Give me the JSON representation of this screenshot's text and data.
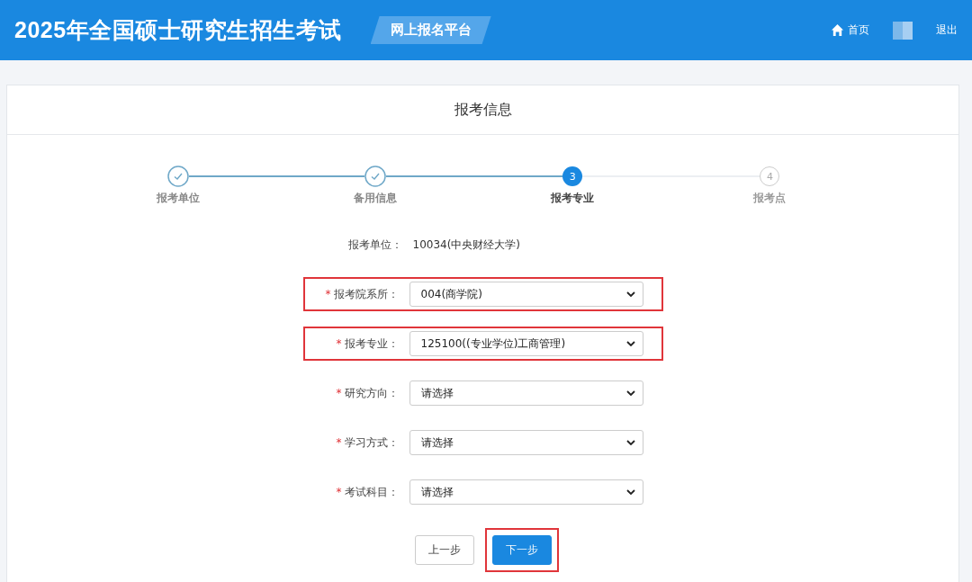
{
  "header": {
    "title": "2025年全国硕士研究生招生考试",
    "badge": "网上报名平台",
    "nav": [
      {
        "kind": "home",
        "label": "首页"
      },
      {
        "kind": "avatar"
      },
      {
        "kind": "link",
        "label": "退出"
      }
    ]
  },
  "panel": {
    "title": "报考信息"
  },
  "steps": [
    {
      "label": "报考单位",
      "completed": true,
      "selected": false
    },
    {
      "label": "备用信息",
      "completed": true,
      "selected": false
    },
    {
      "label": "报考专业",
      "completed": false,
      "selected": true,
      "number": "3"
    },
    {
      "label": "报考点",
      "completed": false,
      "selected": false,
      "number": "4"
    }
  ],
  "form": [
    {
      "kind": "static",
      "label": "报考单位：",
      "value": "10034(中央财经大学)"
    },
    {
      "kind": "select",
      "required_mark": "*",
      "label": "报考院系所：",
      "value": "004(商学院)",
      "highlighted": true
    },
    {
      "kind": "select",
      "required_mark": "*",
      "label": "报考专业：",
      "value": "125100((专业学位)工商管理)",
      "highlighted": true
    },
    {
      "kind": "select",
      "required_mark": "*",
      "label": "研究方向：",
      "value": "请选择",
      "highlighted": false
    },
    {
      "kind": "select",
      "required_mark": "*",
      "label": "学习方式：",
      "value": "请选择",
      "highlighted": false
    },
    {
      "kind": "select",
      "required_mark": "*",
      "label": "考试科目：",
      "value": "请选择",
      "highlighted": false
    }
  ],
  "buttons": [
    {
      "label": "上一步",
      "primary": false,
      "highlighted": false
    },
    {
      "label": "下一步",
      "primary": true,
      "highlighted": true
    }
  ]
}
